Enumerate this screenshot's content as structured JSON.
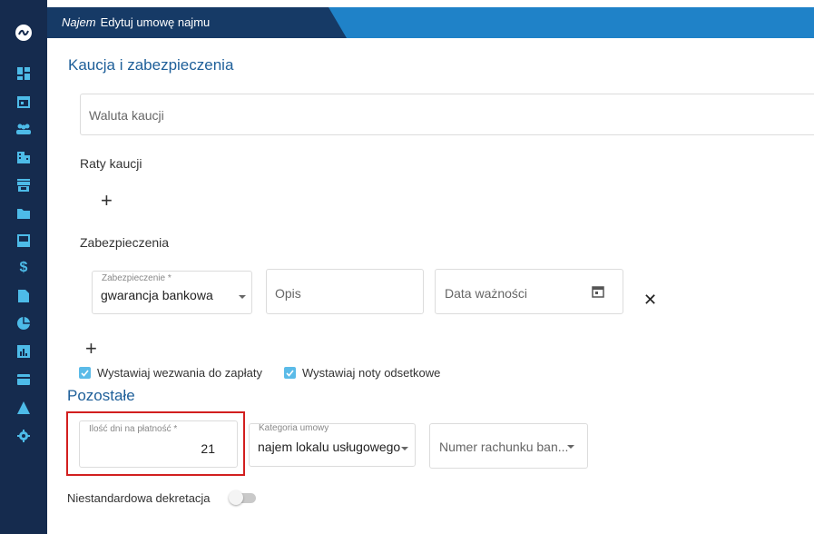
{
  "header": {
    "module": "Najem",
    "title": "Edytuj umowę najmu"
  },
  "sidebar": {
    "icons": [
      "logo-icon",
      "dashboard-icon",
      "calendar-icon",
      "users-icon",
      "building-icon",
      "store-icon",
      "folder-icon",
      "inbox-icon",
      "dollar-icon",
      "document-icon",
      "pie-chart-icon",
      "bar-chart-icon",
      "card-icon",
      "warning-icon",
      "gear-icon"
    ]
  },
  "deposit": {
    "title": "Kaucja i zabezpieczenia",
    "currency_placeholder": "Waluta kaucji",
    "installments_label": "Raty kaucji",
    "add_symbol": "+",
    "securities_label": "Zabezpieczenia",
    "security": {
      "type_label": "Zabezpieczenie *",
      "type_value": "gwarancja bankowa",
      "description_placeholder": "Opis",
      "expiry_placeholder": "Data ważności",
      "remove_symbol": "✕"
    }
  },
  "checkboxes": {
    "payment_calls": "Wystawiaj wezwania do zapłaty",
    "interest_notes": "Wystawiaj noty odsetkowe"
  },
  "other": {
    "title": "Pozostałe",
    "payment_days_label": "Ilość dni na płatność *",
    "payment_days_value": "21",
    "category_label": "Kategoria umowy",
    "category_value": "najem lokalu usługowego",
    "bank_account_placeholder": "Numer rachunku ban...",
    "nonstandard_label": "Niestandardowa dekretacja",
    "nonstandard_on": false
  },
  "colors": {
    "sidebar": "#152b4e",
    "header_dark": "#163a66",
    "header_light": "#1f82c8",
    "accent": "#1e5f99",
    "checkbox": "#5bbbe8",
    "highlight": "#d21f1f"
  }
}
